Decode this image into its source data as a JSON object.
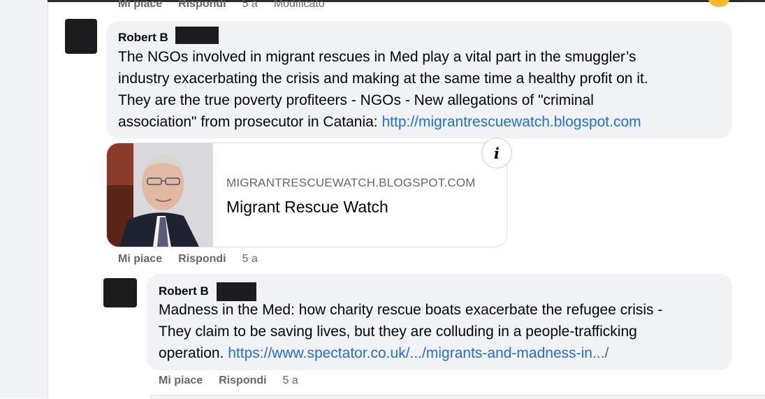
{
  "top_actions": {
    "like": "Mi piace",
    "reply": "Rispondi",
    "time": "5 a",
    "edited": "Modificato"
  },
  "comment1": {
    "author": "Robert B",
    "text": "The NGOs involved in migrant rescues in Med play a vital part in the smuggler’s industry exacerbating the crisis and making at the same time a healthy profit on it. They are the true poverty profiteers - NGOs - New allegations of \"criminal association\" from prosecutor in Catania:",
    "link": "http://migrantrescuewatch.blogspot.com",
    "lines": [
      "The NGOs involved in migrant rescues in Med play a vital part in the smuggler’s",
      "industry exacerbating the crisis and making at the same time a healthy profit on it.",
      "They are the true poverty profiteers - NGOs - New allegations of \"criminal",
      "association\" from prosecutor in Catania: "
    ],
    "card": {
      "domain": "MIGRANTRESCUEWATCH.BLOGSPOT.COM",
      "title": "Migrant Rescue Watch",
      "info_icon": "info-icon"
    },
    "actions": {
      "like": "Mi piace",
      "reply": "Rispondi",
      "time": "5 a"
    }
  },
  "comment2": {
    "author": "Robert B",
    "lines": [
      "Madness in the Med: how charity rescue boats exacerbate the refugee crisis -",
      "They claim to be saving lives, but they are colluding in a people-trafficking",
      "operation. "
    ],
    "link": "https://www.spectator.co.uk/.../migrants-and-madness-in.../",
    "actions": {
      "like": "Mi piace",
      "reply": "Rispondi",
      "time": "5 a"
    }
  },
  "colors": {
    "link": "#216fdb",
    "bubble": "#f0f2f5",
    "secondary_text": "#65676b"
  }
}
